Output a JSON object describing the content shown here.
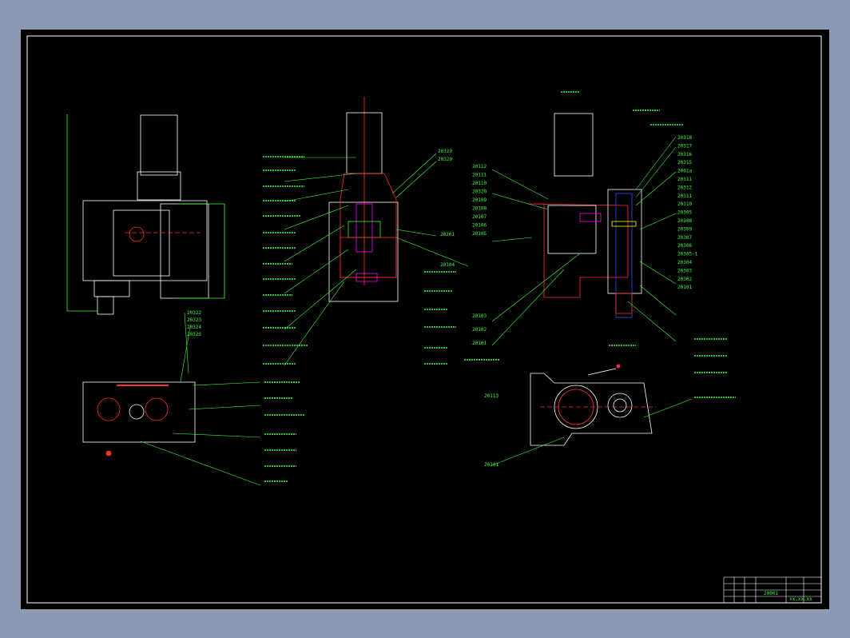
{
  "colors": {
    "background": "#8a9ab4",
    "sheet": "#000000",
    "outline": "#ffffff",
    "leader": "#39ff39",
    "hatch": "#ff3030",
    "accent_magenta": "#ff00ff",
    "accent_blue": "#3050ff",
    "accent_yellow": "#ffff00"
  },
  "view2_top_labels": [
    "20319",
    "20320"
  ],
  "view2_right_labels": [
    "20201",
    "20104"
  ],
  "view3_left_labels": [
    "20112",
    "20111",
    "20110",
    "20320",
    "20109",
    "20108",
    "20107",
    "20106",
    "20105"
  ],
  "view3_left_lower": [
    "20103",
    "20102",
    "20101"
  ],
  "view3_right_labels": [
    "20318",
    "20317",
    "20316",
    "20315",
    "2001a",
    "20311",
    "20312",
    "20311",
    "20310",
    "20305",
    "20308",
    "20309",
    "20307",
    "20306",
    "20305-1",
    "20304",
    "20303",
    "20302",
    "20101"
  ],
  "view4_labels": [
    "20322",
    "20323",
    "20324",
    "20325"
  ],
  "bottom_right_labels": [
    "20113",
    "20101"
  ],
  "title_block": {
    "drawing_no": "20001",
    "cell_text": "xx.xx.xx"
  },
  "icons": [
    "motor-icon",
    "handwheel-icon",
    "gear-icon"
  ]
}
